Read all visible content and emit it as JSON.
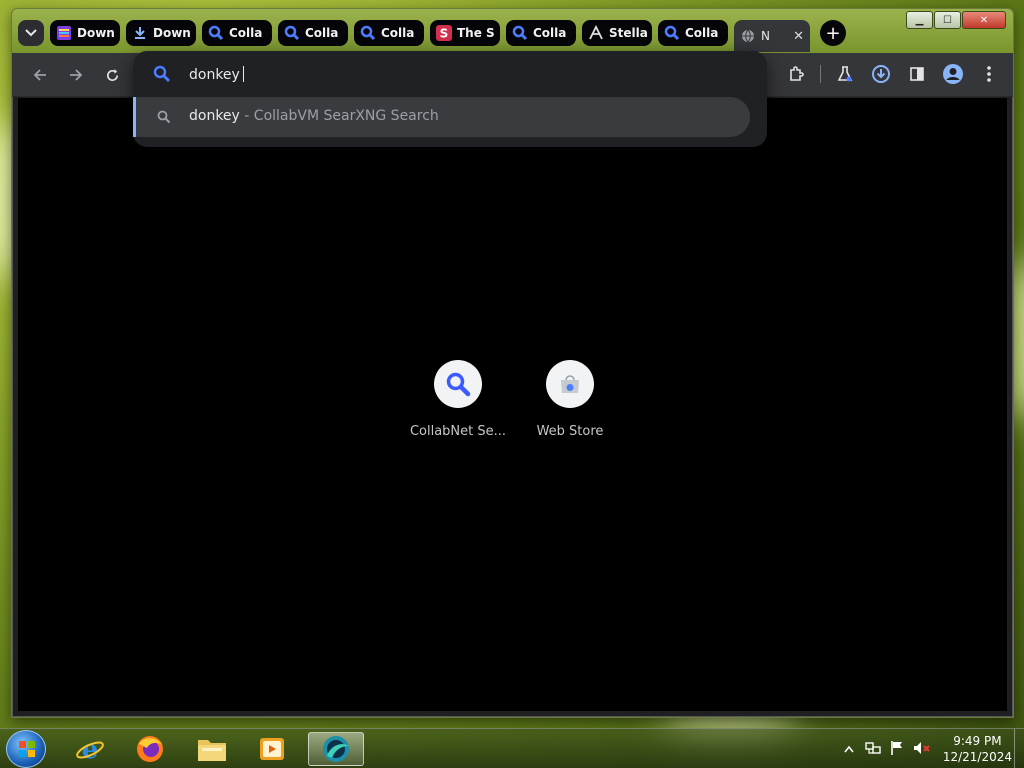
{
  "window": {
    "controls": {
      "minimize": "▁",
      "maximize": "☐",
      "close": "✕"
    }
  },
  "tabs": [
    {
      "label": "Down",
      "icon": "stack-favicon-icon",
      "active": false
    },
    {
      "label": "Down",
      "icon": "download-favicon-icon",
      "active": false
    },
    {
      "label": "Colla",
      "icon": "search-favicon-icon",
      "active": false
    },
    {
      "label": "Colla",
      "icon": "search-favicon-icon",
      "active": false
    },
    {
      "label": "Colla",
      "icon": "search-favicon-icon",
      "active": false
    },
    {
      "label": "The S",
      "icon": "s-favicon-icon",
      "active": false
    },
    {
      "label": "Colla",
      "icon": "search-favicon-icon",
      "active": false
    },
    {
      "label": "Stella",
      "icon": "stellar-favicon-icon",
      "active": false
    },
    {
      "label": "Colla",
      "icon": "search-favicon-icon",
      "active": false
    },
    {
      "label": "N",
      "icon": "globe-favicon-icon",
      "active": true
    }
  ],
  "tab_close": "✕",
  "new_tab": "+",
  "omnibox": {
    "input_value": "donkey",
    "suggestion": {
      "query": "donkey",
      "separator": " - ",
      "engine": "CollabVM SearXNG Search"
    }
  },
  "shortcuts": [
    {
      "label": "CollabNet Se...",
      "icon": "search-icon"
    },
    {
      "label": "Web Store",
      "icon": "web-store-icon"
    }
  ],
  "taskbar": {
    "apps": [
      {
        "name": "internet-explorer",
        "icon": "ie-icon"
      },
      {
        "name": "firefox",
        "icon": "firefox-icon"
      },
      {
        "name": "file-explorer",
        "icon": "folder-icon"
      },
      {
        "name": "media-player",
        "icon": "media-player-icon"
      },
      {
        "name": "chrome-browser",
        "icon": "browser-icon",
        "active": true
      }
    ],
    "clock": {
      "time": "9:49 PM",
      "date": "12/21/2024"
    }
  },
  "colors": {
    "tab_active_bg": "#35363a",
    "omnibox_bg": "#202124",
    "accent_blue": "#8ab4f8",
    "content_bg": "#000000"
  }
}
